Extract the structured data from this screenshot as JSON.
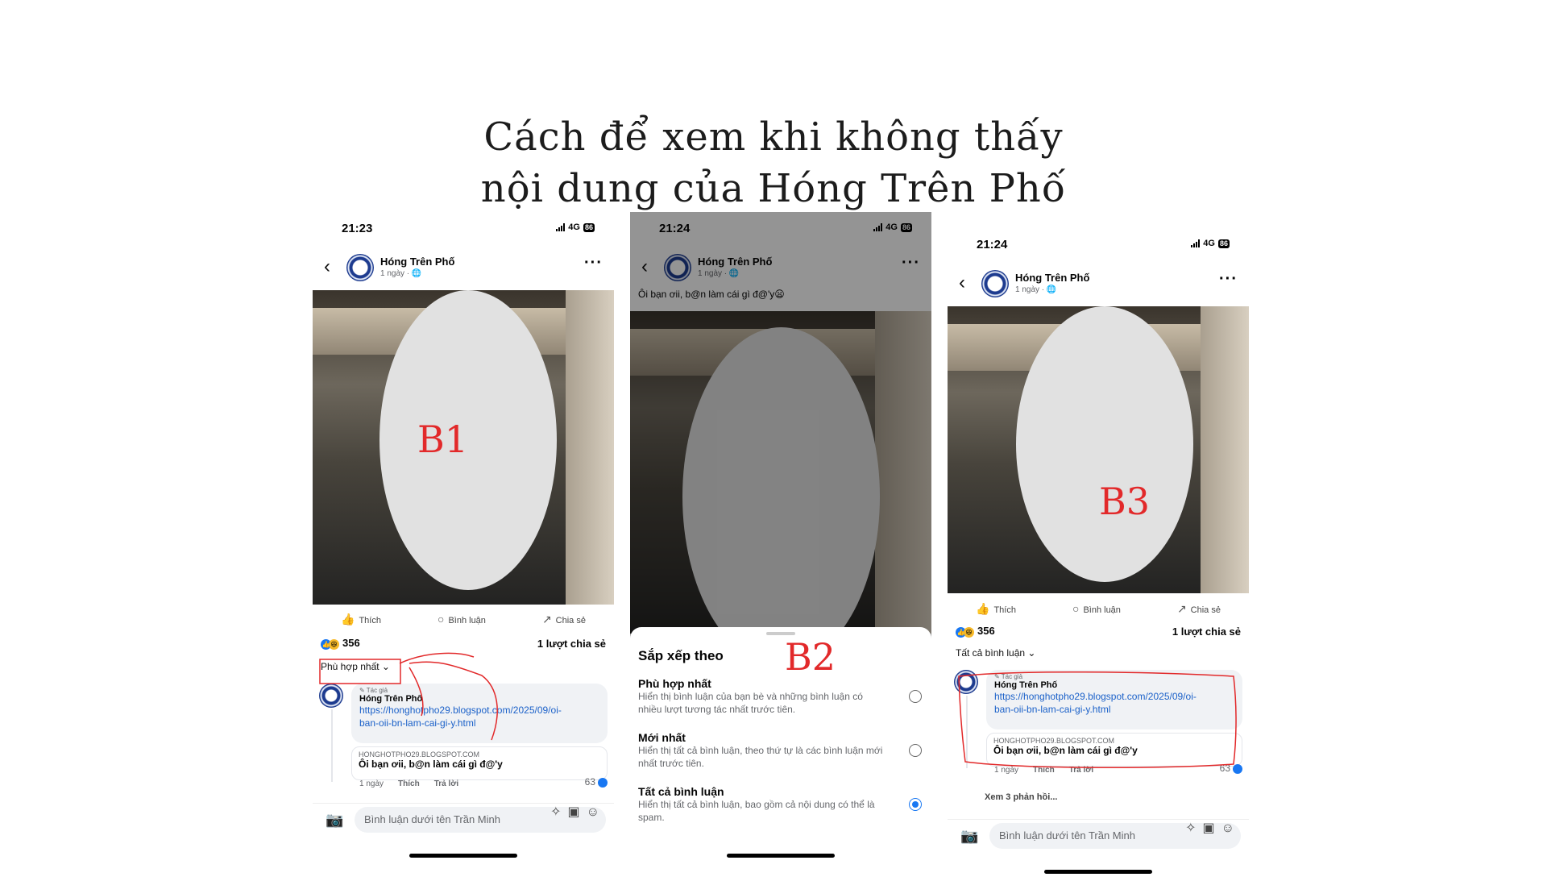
{
  "title": {
    "line1": "Cách để xem khi không thấy",
    "line2": "nội dung của Hóng Trên Phố"
  },
  "common": {
    "page_name": "Hóng Trên Phố",
    "post_meta": "1 ngày · 🌐",
    "network": "4G",
    "battery": "86",
    "like_label": "Thích",
    "comment_label": "Bình luận",
    "share_label": "Chia sẻ",
    "reactions_count": "356",
    "shares_label": "1 lượt chia sẻ",
    "author_tag": "Tác giả",
    "comment_link_a": "https://honghotpho29.blogspot.com/2025/09/oi-",
    "comment_link_b": "ban-oii-bn-lam-cai-gi-y.html",
    "preview_domain": "HONGHOTPHO29.BLOGSPOT.COM",
    "preview_title": "Ôi bạn ơii, b@n làm cái gì đ@'y",
    "comment_time": "1 ngày",
    "comment_like": "Thích",
    "comment_reply": "Trả lời",
    "comment_likes": "63",
    "input_placeholder": "Bình luận dưới tên Trần Minh"
  },
  "phone1": {
    "time": "21:23",
    "step_label": "B1",
    "sort_label": "Phù hợp nhất ⌄"
  },
  "phone2": {
    "time": "21:24",
    "step_label": "B2",
    "caption": "Ôi bạn ơii, b@n làm cái gì đ@'y😦",
    "sheet_title": "Sắp xếp theo",
    "options": [
      {
        "name": "Phù hợp nhất",
        "desc": "Hiển thị bình luận của bạn bè và những bình luận có nhiều lượt tương tác nhất trước tiên.",
        "selected": false
      },
      {
        "name": "Mới nhất",
        "desc": "Hiển thị tất cả bình luận, theo thứ tự là các bình luận mới nhất trước tiên.",
        "selected": false
      },
      {
        "name": "Tất cả bình luận",
        "desc": "Hiển thị tất cả bình luận, bao gồm cả nội dung có thể là spam.",
        "selected": true
      }
    ]
  },
  "phone3": {
    "time": "21:24",
    "step_label": "B3",
    "sort_label": "Tất cả bình luận ⌄",
    "more_replies": "Xem 3 phản hồi..."
  },
  "colors": {
    "annotation": "#e2292a",
    "link": "#1b61c9",
    "facebook_blue": "#1877f2"
  }
}
